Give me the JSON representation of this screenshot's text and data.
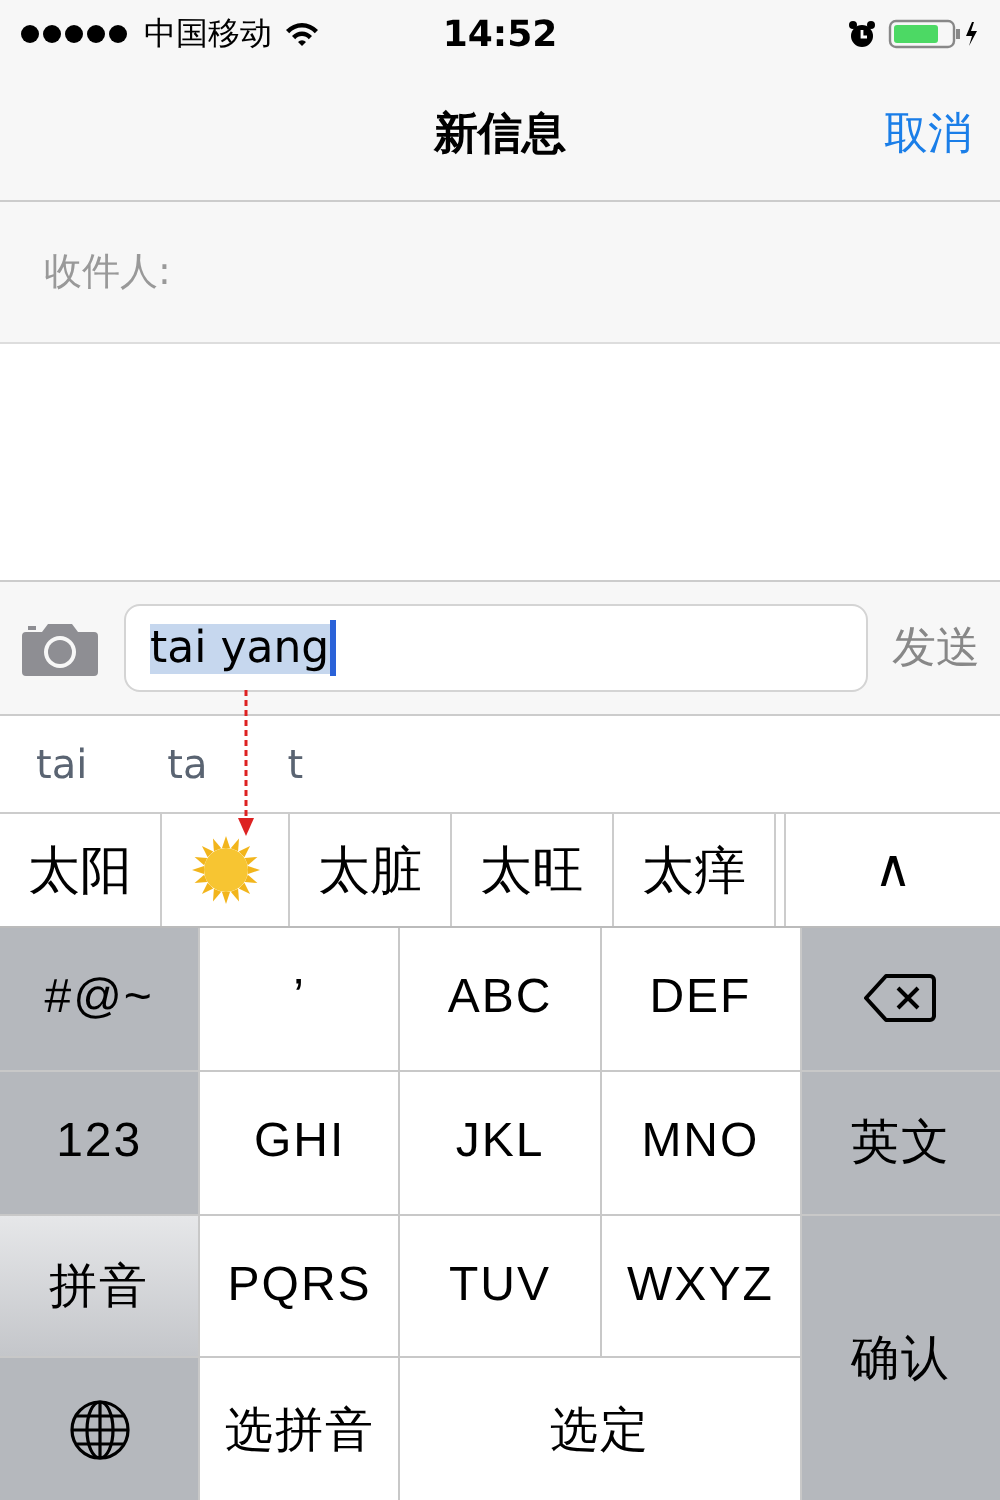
{
  "status_bar": {
    "carrier": "中国移动",
    "time": "14:52"
  },
  "nav": {
    "title": "新信息",
    "cancel": "取消"
  },
  "recipient": {
    "label": "收件人:"
  },
  "compose": {
    "value": "tai yang",
    "send": "发送"
  },
  "pinyin_options": [
    "tai",
    "ta",
    "t"
  ],
  "candidates": [
    {
      "kind": "text",
      "text": "太阳"
    },
    {
      "kind": "emoji"
    },
    {
      "kind": "text",
      "text": "太脏"
    },
    {
      "kind": "text",
      "text": "太旺"
    },
    {
      "kind": "text",
      "text": "太痒"
    }
  ],
  "expand": "∧",
  "keys": [
    {
      "kind": "function",
      "label": "#@~",
      "selected": false
    },
    {
      "kind": "letter",
      "label": "’",
      "selected": false
    },
    {
      "kind": "letter",
      "label": "ABC",
      "selected": false
    },
    {
      "kind": "letter",
      "label": "DEF",
      "selected": false
    },
    {
      "kind": "delete",
      "selected": false
    },
    {
      "kind": "function",
      "label": "123",
      "selected": false
    },
    {
      "kind": "letter",
      "label": "GHI",
      "selected": false
    },
    {
      "kind": "letter",
      "label": "JKL",
      "selected": false
    },
    {
      "kind": "letter",
      "label": "MNO",
      "selected": false
    },
    {
      "kind": "function",
      "label": "英文",
      "selected": false
    },
    {
      "kind": "function",
      "label": "拼音",
      "selected": true
    },
    {
      "kind": "letter",
      "label": "PQRS",
      "selected": false
    },
    {
      "kind": "letter",
      "label": "TUV",
      "selected": false
    },
    {
      "kind": "letter",
      "label": "WXYZ",
      "selected": false
    },
    {
      "kind": "enter",
      "label": "确认",
      "selected": false
    },
    {
      "kind": "globe",
      "selected": false
    },
    {
      "kind": "letter",
      "label": "选拼音",
      "selected": false
    },
    {
      "kind": "space",
      "label": "选定",
      "selected": false
    }
  ]
}
